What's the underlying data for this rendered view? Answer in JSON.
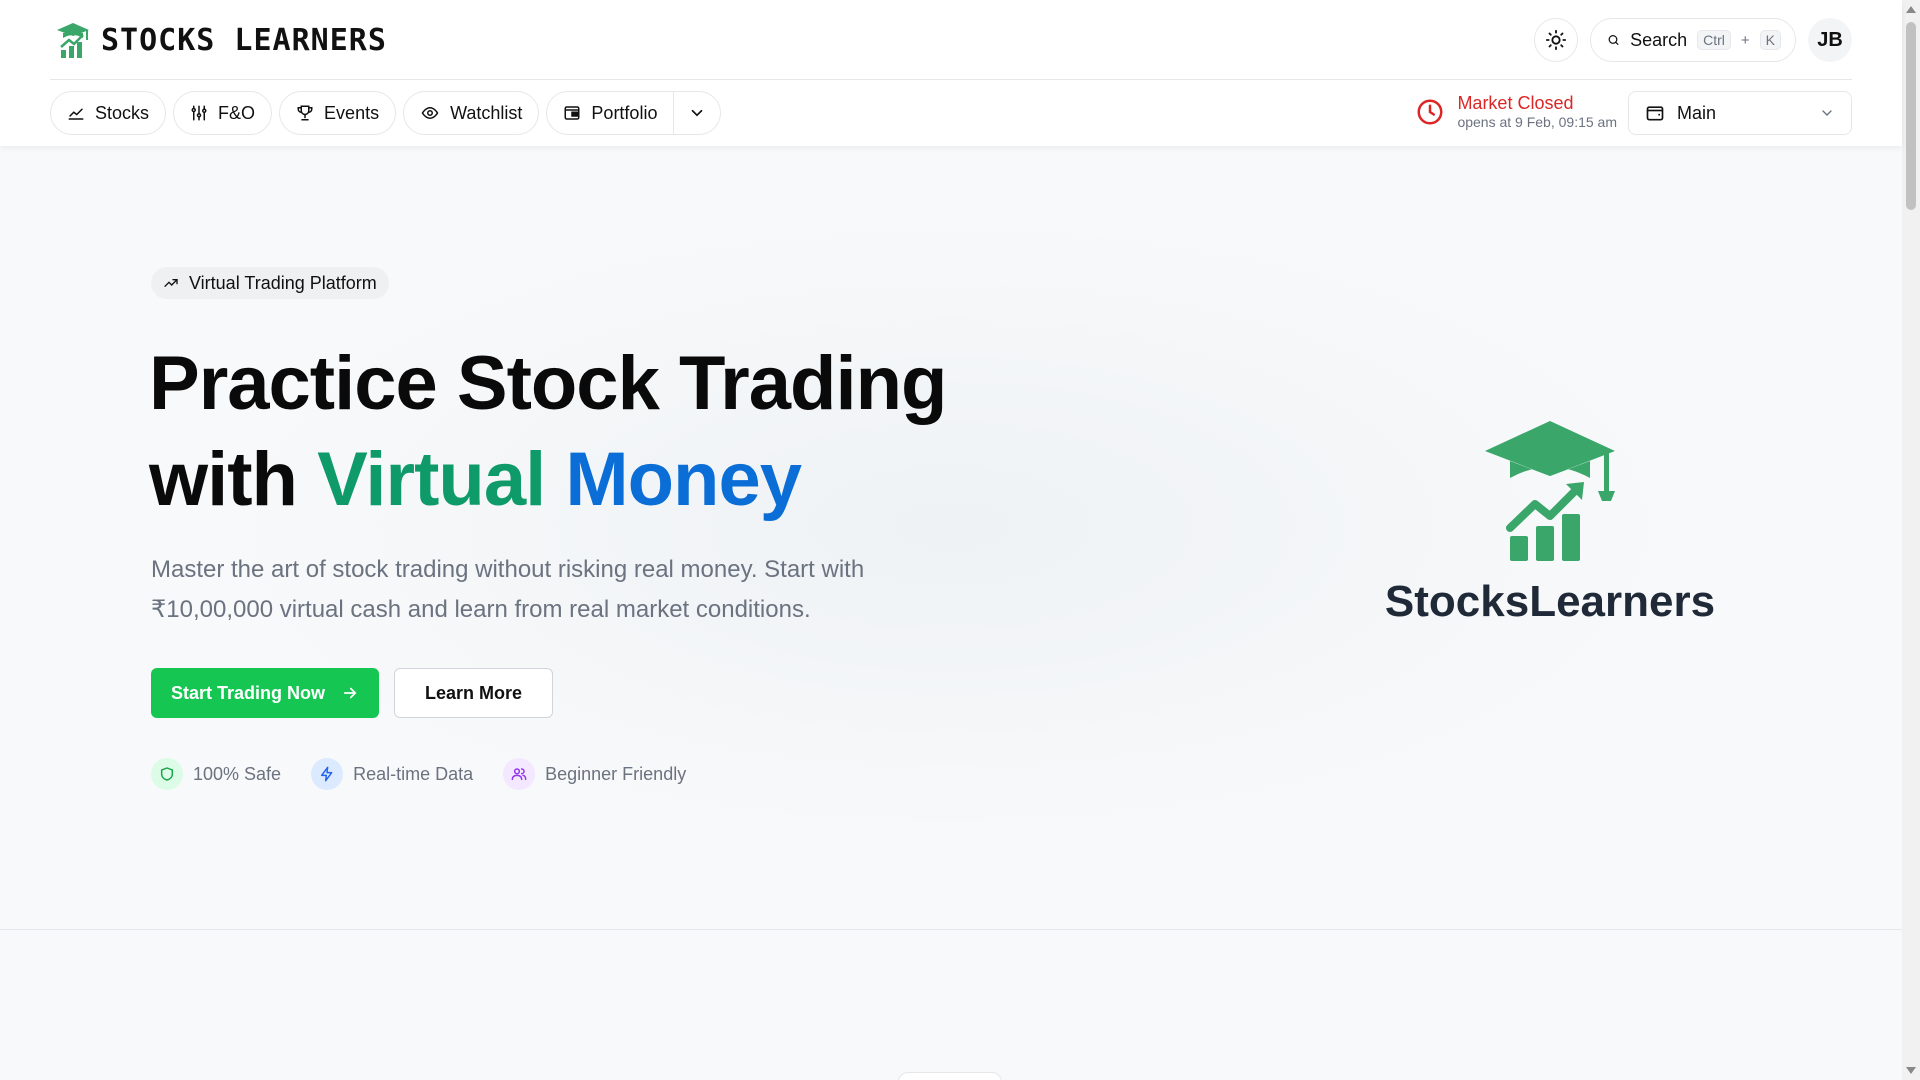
{
  "header": {
    "logo_text": "STOCKS LEARNERS",
    "search": {
      "label": "Search",
      "shortcut_key1": "Ctrl",
      "shortcut_plus": "+",
      "shortcut_key2": "K"
    },
    "avatar_initials": "JB",
    "theme_icon": "sun-icon"
  },
  "nav": {
    "items": [
      {
        "label": "Stocks",
        "icon": "chart-line-icon"
      },
      {
        "label": "F&O",
        "icon": "sliders-icon"
      },
      {
        "label": "Events",
        "icon": "trophy-icon"
      },
      {
        "label": "Watchlist",
        "icon": "eye-icon"
      },
      {
        "label": "Portfolio",
        "icon": "wallet-icon"
      }
    ],
    "more_icon": "chevron-down-icon"
  },
  "market": {
    "status": "Market Closed",
    "opens_text": "opens at 9 Feb, 09:15 am",
    "status_color": "#dc2626"
  },
  "account": {
    "label": "Main"
  },
  "hero": {
    "badge": "Virtual Trading Platform",
    "headline_line1": "Practice Stock Trading",
    "headline_with": "with ",
    "headline_virtual": "Virtual",
    "headline_money": "Money",
    "lede": "Master the art of stock trading without risking real money. Start with ₹10,00,000 virtual cash and learn from real market conditions.",
    "cta_primary": "Start Trading Now",
    "cta_secondary": "Learn More",
    "features": [
      {
        "label": "100% Safe",
        "icon": "shield-icon"
      },
      {
        "label": "Real-time Data",
        "icon": "lightning-icon"
      },
      {
        "label": "Beginner Friendly",
        "icon": "users-icon"
      }
    ],
    "brand_name": "StocksLearners"
  },
  "colors": {
    "primary_green": "#16c653",
    "brand_green": "#3aa66a",
    "accent_teal": "#0f9a6a",
    "accent_blue": "#0b6ed6"
  }
}
